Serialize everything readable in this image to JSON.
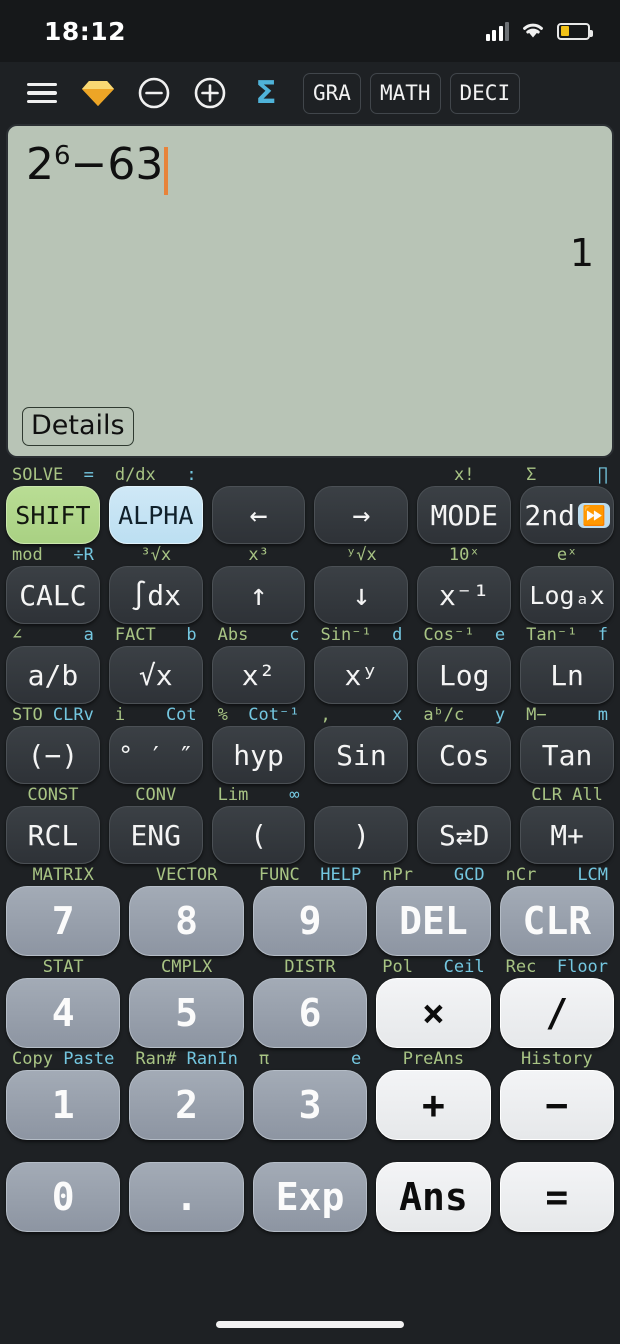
{
  "status": {
    "time": "18:12",
    "signal_icon": "signal-bars-icon",
    "wifi_icon": "wifi-icon",
    "battery_icon": "battery-icon",
    "battery_level_percent": 32,
    "battery_color": "#f2c117"
  },
  "toolbar": {
    "menu_icon": "hamburger-menu-icon",
    "gem_icon": "gem-icon",
    "gem_color": "#f5b127",
    "zoom_out_icon": "circle-minus-icon",
    "zoom_in_icon": "circle-plus-icon",
    "sigma_icon": "sigma-icon",
    "sigma_color": "#4fb3d9",
    "chips": [
      "GRA",
      "MATH",
      "DECI"
    ]
  },
  "display": {
    "expression_base": "2",
    "expression_exponent": "6",
    "expression_rest": "−63",
    "result": "1",
    "details_label": "Details",
    "background": "#b8c4b6",
    "cursor_color": "#e8833a"
  },
  "keypad": {
    "rows": [
      {
        "keys": [
          {
            "label": "SHIFT",
            "style": "shiftkey"
          },
          {
            "label": "ALPHA",
            "style": "alphakey"
          },
          {
            "label": "←",
            "style": "arrow"
          },
          {
            "label": "→",
            "style": "arrow"
          },
          {
            "label": "MODE",
            "style": "plain"
          },
          {
            "label": "2nd",
            "style": "plain",
            "badge": "⏩"
          }
        ],
        "sublabels": [
          {
            "shift": "SOLVE",
            "alpha": "="
          },
          {
            "shift": "d/dx",
            "alpha": ":"
          },
          {
            "shift": "",
            "alpha": ""
          },
          {
            "shift": "",
            "alpha": ""
          },
          {
            "shift": "x!",
            "alpha": ""
          },
          {
            "shift": "Σ",
            "alpha": "∏"
          }
        ]
      },
      {
        "keys": [
          {
            "label": "CALC",
            "style": "plain"
          },
          {
            "label": "∫dx",
            "style": "plain"
          },
          {
            "label": "↑",
            "style": "arrow"
          },
          {
            "label": "↓",
            "style": "arrow"
          },
          {
            "label": "x⁻¹",
            "style": "plain"
          },
          {
            "label": "Logₐx",
            "style": "plain"
          }
        ],
        "sublabels": [
          {
            "shift": "mod",
            "alpha": "÷R"
          },
          {
            "shift": "³√x",
            "alpha": ""
          },
          {
            "shift": "x³",
            "alpha": ""
          },
          {
            "shift": "ʸ√x",
            "alpha": ""
          },
          {
            "shift": "10ˣ",
            "alpha": ""
          },
          {
            "shift": "eˣ",
            "alpha": ""
          }
        ]
      },
      {
        "keys": [
          {
            "label": "a/b",
            "style": "plain"
          },
          {
            "label": "√x",
            "style": "plain"
          },
          {
            "label": "x²",
            "style": "plain"
          },
          {
            "label": "xʸ",
            "style": "plain"
          },
          {
            "label": "Log",
            "style": "plain"
          },
          {
            "label": "Ln",
            "style": "plain"
          }
        ],
        "sublabels": [
          {
            "shift": "∠",
            "alpha": "a"
          },
          {
            "shift": "FACT",
            "alpha": "b"
          },
          {
            "shift": "Abs",
            "alpha": "c"
          },
          {
            "shift": "Sin⁻¹",
            "alpha": "d"
          },
          {
            "shift": "Cos⁻¹",
            "alpha": "e"
          },
          {
            "shift": "Tan⁻¹",
            "alpha": "f"
          }
        ]
      },
      {
        "keys": [
          {
            "label": "(−)",
            "style": "plain"
          },
          {
            "label": "° ′ ″",
            "style": "plain"
          },
          {
            "label": "hyp",
            "style": "plain"
          },
          {
            "label": "Sin",
            "style": "plain"
          },
          {
            "label": "Cos",
            "style": "plain"
          },
          {
            "label": "Tan",
            "style": "plain"
          }
        ],
        "sublabels": [
          {
            "shift": "STO",
            "alpha": "CLRv"
          },
          {
            "shift": "i",
            "alpha": "Cot"
          },
          {
            "shift": "%",
            "alpha": "Cot⁻¹"
          },
          {
            "shift": ",",
            "alpha": "x"
          },
          {
            "shift": "aᵇ/c",
            "alpha": "y"
          },
          {
            "shift": "M−",
            "alpha": "m"
          }
        ]
      },
      {
        "keys": [
          {
            "label": "RCL",
            "style": "plain"
          },
          {
            "label": "ENG",
            "style": "plain"
          },
          {
            "label": "(",
            "style": "plain"
          },
          {
            "label": ")",
            "style": "plain"
          },
          {
            "label": "S⇄D",
            "style": "plain"
          },
          {
            "label": "M+",
            "style": "plain"
          }
        ],
        "sublabels": [
          {
            "shift": "CONST",
            "alpha": ""
          },
          {
            "shift": "CONV",
            "alpha": ""
          },
          {
            "shift": "Lim",
            "alpha": "∞"
          },
          {
            "shift": "",
            "alpha": ""
          },
          {
            "shift": "",
            "alpha": ""
          },
          {
            "shift": "CLR All",
            "alpha": ""
          }
        ]
      },
      {
        "keys": [
          {
            "label": "7",
            "style": "num"
          },
          {
            "label": "8",
            "style": "num"
          },
          {
            "label": "9",
            "style": "num"
          },
          {
            "label": "DEL",
            "style": "num"
          },
          {
            "label": "CLR",
            "style": "num"
          }
        ],
        "sublabels": [
          {
            "shift": "MATRIX",
            "alpha": ""
          },
          {
            "shift": "VECTOR",
            "alpha": ""
          },
          {
            "shift": "FUNC",
            "alpha": "HELP"
          },
          {
            "shift": "nPr",
            "alpha": "GCD"
          },
          {
            "shift": "nCr",
            "alpha": "LCM"
          }
        ]
      },
      {
        "keys": [
          {
            "label": "4",
            "style": "num"
          },
          {
            "label": "5",
            "style": "num"
          },
          {
            "label": "6",
            "style": "num"
          },
          {
            "label": "×",
            "style": "op"
          },
          {
            "label": "/",
            "style": "op"
          }
        ],
        "sublabels": [
          {
            "shift": "STAT",
            "alpha": ""
          },
          {
            "shift": "CMPLX",
            "alpha": ""
          },
          {
            "shift": "DISTR",
            "alpha": ""
          },
          {
            "shift": "Pol",
            "alpha": "Ceil"
          },
          {
            "shift": "Rec",
            "alpha": "Floor"
          }
        ]
      },
      {
        "keys": [
          {
            "label": "1",
            "style": "num"
          },
          {
            "label": "2",
            "style": "num"
          },
          {
            "label": "3",
            "style": "num"
          },
          {
            "label": "+",
            "style": "op"
          },
          {
            "label": "−",
            "style": "op"
          }
        ],
        "sublabels": [
          {
            "shift": "Copy",
            "alpha": "Paste"
          },
          {
            "shift": "Ran#",
            "alpha": "RanIn"
          },
          {
            "shift": "π",
            "alpha": "e"
          },
          {
            "shift": "PreAns",
            "alpha": ""
          },
          {
            "shift": "History",
            "alpha": ""
          }
        ]
      },
      {
        "keys": [
          {
            "label": "0",
            "style": "num"
          },
          {
            "label": ".",
            "style": "num"
          },
          {
            "label": "Exp",
            "style": "num"
          },
          {
            "label": "Ans",
            "style": "op"
          },
          {
            "label": "=",
            "style": "op"
          }
        ],
        "sublabels": []
      }
    ]
  }
}
